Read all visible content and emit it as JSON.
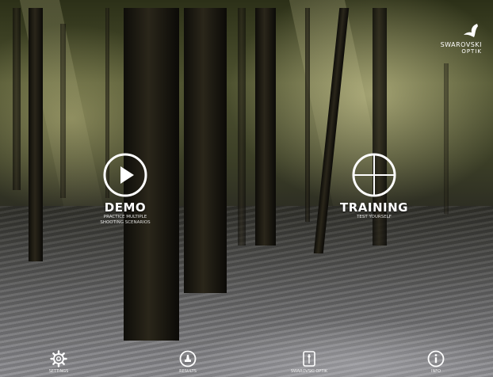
{
  "brand": {
    "name": "SWAROVSKI",
    "sub": "OPTIK"
  },
  "modes": {
    "demo": {
      "title": "DEMO",
      "description_line1": "PRACTICE MULTIPLE",
      "description_line2": "SHOOTING SCENARIOS",
      "icon": "play-icon"
    },
    "training": {
      "title": "TRAINING",
      "description_line1": "TEST YOURSELF",
      "description_line2": "",
      "icon": "crosshair-icon"
    }
  },
  "tabs": [
    {
      "label": "SETTINGS",
      "icon": "gear-icon"
    },
    {
      "label": "RESULTS",
      "icon": "results-icon"
    },
    {
      "label": "SWAROVSKI OPTIK",
      "icon": "scope-icon"
    },
    {
      "label": "INFO",
      "icon": "info-icon"
    }
  ],
  "colors": {
    "icon": "#ffffff",
    "text": "#ffffff"
  }
}
